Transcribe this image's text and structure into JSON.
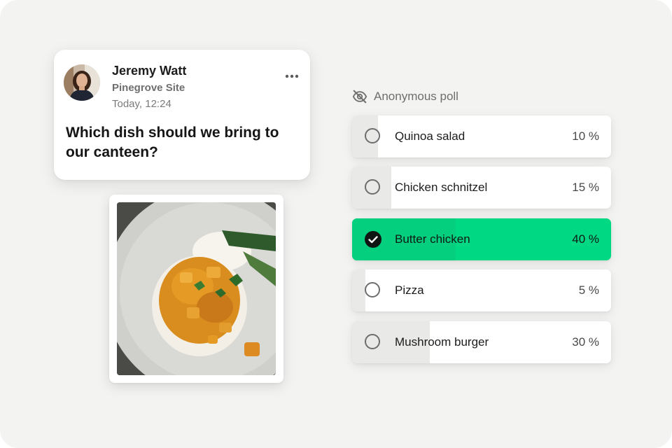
{
  "post": {
    "author_name": "Jeremy Watt",
    "author_site": "Pinegrove Site",
    "timestamp": "Today, 12:24",
    "question": "Which dish should we bring to our canteen?",
    "more_icon": "more-horizontal-icon"
  },
  "poll": {
    "label": "Anonymous poll",
    "label_icon": "eye-off-icon",
    "accent_color": "#00d884",
    "options": [
      {
        "label": "Quinoa salad",
        "percent_text": "10 %",
        "percent": 10,
        "selected": false
      },
      {
        "label": "Chicken schnitzel",
        "percent_text": "15 %",
        "percent": 15,
        "selected": false
      },
      {
        "label": "Butter chicken",
        "percent_text": "40 %",
        "percent": 40,
        "selected": true
      },
      {
        "label": "Pizza",
        "percent_text": "5 %",
        "percent": 5,
        "selected": false
      },
      {
        "label": "Mushroom burger",
        "percent_text": "30 %",
        "percent": 30,
        "selected": false
      }
    ]
  }
}
